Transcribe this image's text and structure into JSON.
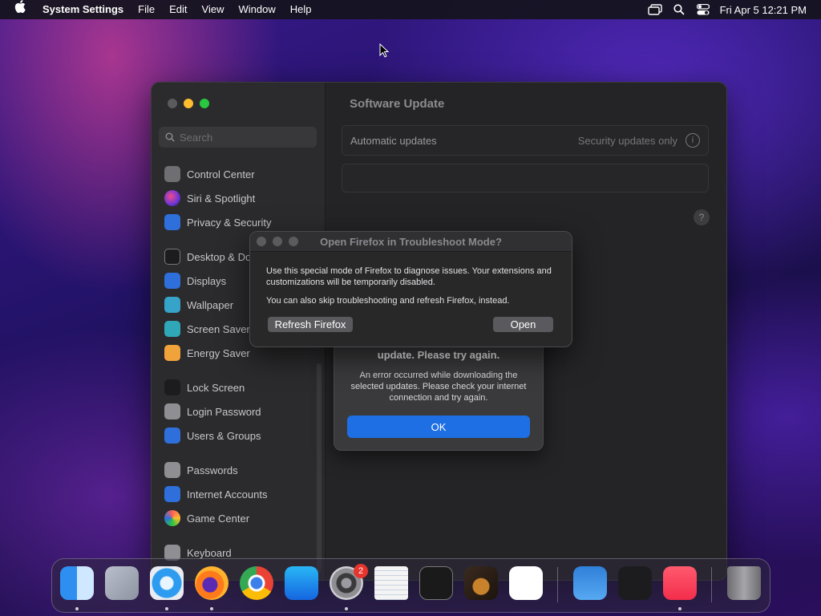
{
  "menubar": {
    "app_name": "System Settings",
    "menus": [
      "File",
      "Edit",
      "View",
      "Window",
      "Help"
    ],
    "clock": "Fri Apr 5  12:21 PM"
  },
  "sidebar": {
    "search_placeholder": "Search",
    "items": [
      {
        "label": "Control Center",
        "icon": "control-center-icon"
      },
      {
        "label": "Siri & Spotlight",
        "icon": "siri-icon"
      },
      {
        "label": "Privacy & Security",
        "icon": "hand-icon"
      },
      {
        "label": "Desktop & Dock",
        "icon": "dock-icon"
      },
      {
        "label": "Displays",
        "icon": "sun-icon"
      },
      {
        "label": "Wallpaper",
        "icon": "wallpaper-icon"
      },
      {
        "label": "Screen Saver",
        "icon": "screen-saver-icon"
      },
      {
        "label": "Energy Saver",
        "icon": "battery-icon"
      },
      {
        "label": "Lock Screen",
        "icon": "lock-icon"
      },
      {
        "label": "Login Password",
        "icon": "lock-icon"
      },
      {
        "label": "Users & Groups",
        "icon": "users-icon"
      },
      {
        "label": "Passwords",
        "icon": "key-icon"
      },
      {
        "label": "Internet Accounts",
        "icon": "at-icon"
      },
      {
        "label": "Game Center",
        "icon": "game-center-icon"
      },
      {
        "label": "Keyboard",
        "icon": "keyboard-icon"
      }
    ]
  },
  "main": {
    "title": "Software Update",
    "automatic_updates_label": "Automatic updates",
    "automatic_updates_value": "Security updates only",
    "info_glyph": "i",
    "help_glyph": "?"
  },
  "error_sheet": {
    "title": "update. Please try again.",
    "body": "An error occurred while downloading the selected updates. Please check your internet connection and try again.",
    "ok_label": "OK"
  },
  "firefox_dialog": {
    "title": "Open Firefox in Troubleshoot Mode?",
    "message1": "Use this special mode of Firefox to diagnose issues. Your extensions and customizations will be temporarily disabled.",
    "message2": "You can also skip troubleshooting and refresh Firefox, instead.",
    "refresh_label": "Refresh Firefox",
    "open_label": "Open"
  },
  "dock": {
    "apps": [
      "Finder",
      "Launchpad",
      "Safari",
      "Firefox",
      "Chrome",
      "App Store",
      "System Settings",
      "TextEdit",
      "Terminal",
      "GarageBand",
      "Visual Studio Code",
      "Weather",
      "Stocks",
      "Music",
      "Trash"
    ],
    "settings_badge": "2"
  },
  "colors": {
    "accent": "#1d6fe3",
    "close": "#ff5f57",
    "minimize": "#febc2e",
    "zoom": "#28c840",
    "badge": "#e7352d"
  }
}
